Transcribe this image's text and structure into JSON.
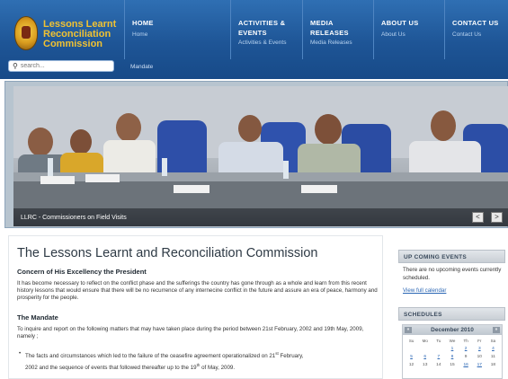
{
  "logo": {
    "lines": [
      "Lessons Learnt",
      "Reconciliation",
      "Commission"
    ]
  },
  "nav": [
    {
      "title": "HOME",
      "title2": "",
      "sub": "Home"
    },
    {
      "title": "ACTIVITIES &",
      "title2": "EVENTS",
      "sub": "Activities & Events"
    },
    {
      "title": "MEDIA",
      "title2": "RELEASES",
      "sub": "Media Releases"
    },
    {
      "title": "ABOUT US",
      "title2": "",
      "sub": "About Us"
    },
    {
      "title": "CONTACT US",
      "title2": "",
      "sub": "Contact Us"
    }
  ],
  "search": {
    "placeholder": "search..."
  },
  "subnav": {
    "label": "Mandate"
  },
  "slideshow": {
    "caption": "LLRC - Commissioners on Field Visits",
    "prev": "<",
    "next": ">"
  },
  "content": {
    "title": "The Lessons Learnt and Reconciliation Commission",
    "concern_heading": "Concern of His Excellency the President",
    "concern_text": "It has become necessary to reflect on the conflict phase and the sufferings the country has gone through as a whole and learn from this recent history lessons that would ensure that there will be no recurrence of any internecine conflict in the future and assure an era of peace, harmony and prosperity for the people.",
    "mandate_heading": "The Mandate",
    "mandate_text": "To inquire and report on the following matters that may have taken place during the period between 21st February, 2002 and 19th May, 2009, namely ;",
    "bullet_part1": "The facts and circumstances which led to the failure of the ceasefire agreement operationalized on 21",
    "bullet_sup1": "st",
    "bullet_part2": " February,",
    "bullet_part3": "2002 and the sequence of events that followed thereafter up to the 19",
    "bullet_sup2": "th",
    "bullet_part4": " of May, 2009."
  },
  "sidebar": {
    "upcoming_heading": "Up Coming Events",
    "upcoming_text": "There are no upcoming events currently scheduled.",
    "calendar_link": "View full calendar",
    "schedules_heading": "Schedules",
    "calendar": {
      "month": "December 2010",
      "prev": "«",
      "next": "»",
      "day_headers": [
        "Su",
        "Mo",
        "Tu",
        "We",
        "Th",
        "Fr",
        "Sa"
      ],
      "rows": [
        [
          "",
          "",
          "",
          "1",
          "2",
          "3",
          "4"
        ],
        [
          "5",
          "6",
          "7",
          "8",
          "9",
          "10",
          "11"
        ],
        [
          "12",
          "13",
          "14",
          "15",
          "16",
          "17",
          "18"
        ]
      ],
      "linked_days": [
        "1",
        "2",
        "3",
        "4",
        "5",
        "6",
        "7",
        "8",
        "16",
        "17"
      ]
    }
  },
  "colors": {
    "header_blue": "#1e5596",
    "logo_gold": "#f1c232",
    "link_blue": "#2a66b4"
  }
}
